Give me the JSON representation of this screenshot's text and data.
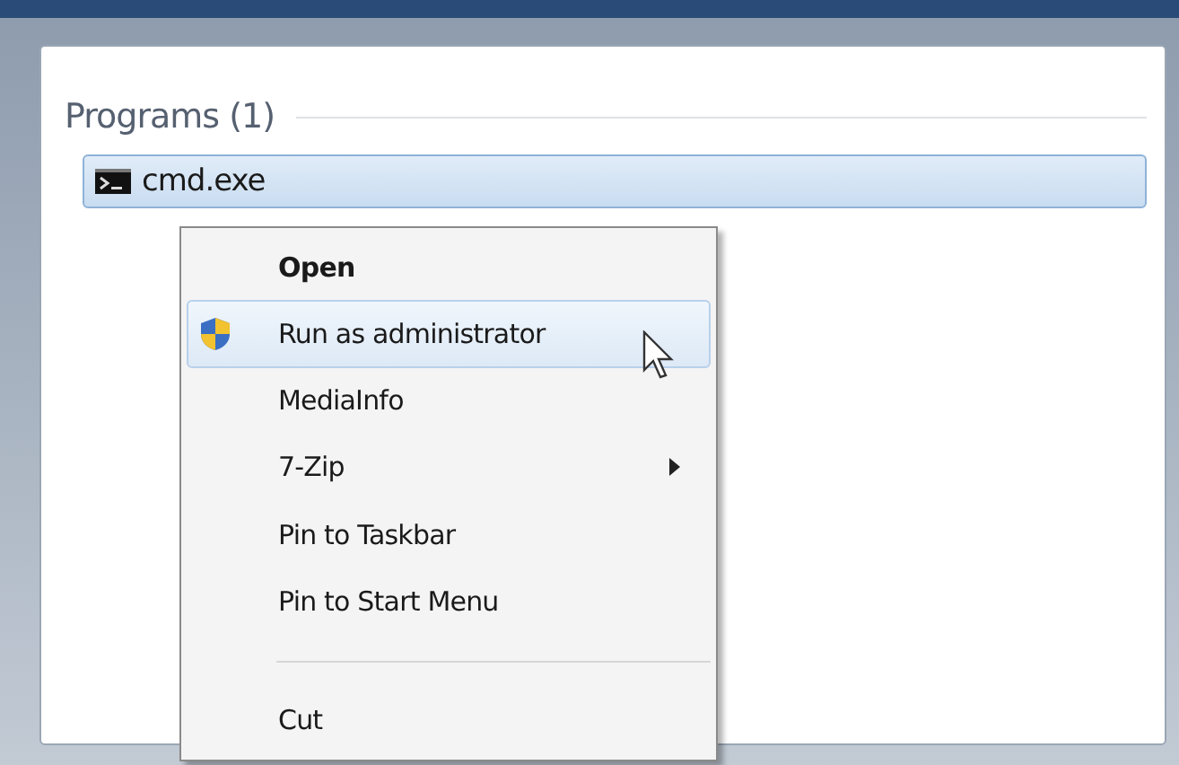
{
  "section": {
    "title": "Programs (1)"
  },
  "results": [
    {
      "label": "cmd.exe",
      "selected": true
    }
  ],
  "context_menu": [
    {
      "kind": "item",
      "label": "Open",
      "bold": true,
      "selected": false,
      "submenu": false,
      "shield": false
    },
    {
      "kind": "item",
      "label": "Run as administrator",
      "bold": false,
      "selected": true,
      "submenu": false,
      "shield": true
    },
    {
      "kind": "item",
      "label": "MediaInfo",
      "bold": false,
      "selected": false,
      "submenu": false,
      "shield": false
    },
    {
      "kind": "item",
      "label": "7-Zip",
      "bold": false,
      "selected": false,
      "submenu": true,
      "shield": false
    },
    {
      "kind": "item",
      "label": "Pin to Taskbar",
      "bold": false,
      "selected": false,
      "submenu": false,
      "shield": false
    },
    {
      "kind": "item",
      "label": "Pin to Start Menu",
      "bold": false,
      "selected": false,
      "submenu": false,
      "shield": false
    },
    {
      "kind": "separator"
    },
    {
      "kind": "item",
      "label": "Cut",
      "bold": false,
      "selected": false,
      "submenu": false,
      "shield": false
    }
  ]
}
